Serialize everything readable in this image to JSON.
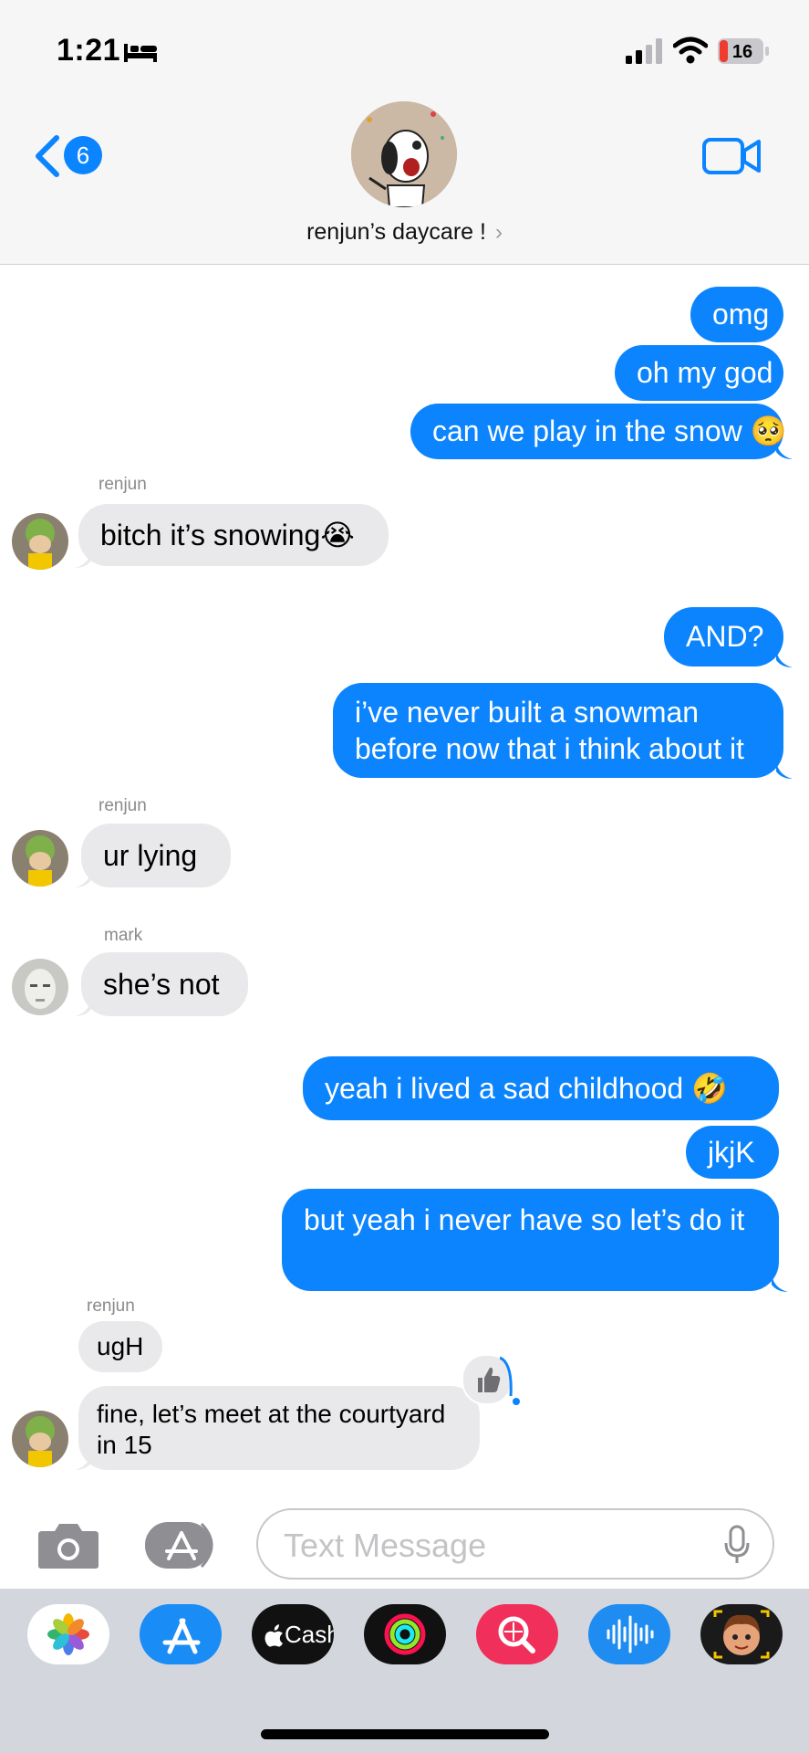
{
  "status_bar": {
    "time": "1:21",
    "battery": "16"
  },
  "header": {
    "back_badge": "6",
    "group_name": "renjun’s daycare !",
    "chevron": "›"
  },
  "messages": {
    "m1": "omg",
    "m2": "oh my god",
    "m3": "can we play in the snow 🥺",
    "s1": "renjun",
    "m4": "bitch it’s snowing😭",
    "m5": "AND?",
    "m6": "i’ve never built a snowman before now that i think about it",
    "s2": "renjun",
    "m7": "ur lying",
    "s3": "mark",
    "m8": "she’s not",
    "m9": "yeah i lived a sad childhood 🤣",
    "m10": "jkjK",
    "m11": "but yeah i never have so let’s do it",
    "s4": "renjun",
    "m12": "ugH",
    "m13": "fine, let’s meet at the courtyard in 15"
  },
  "compose": {
    "placeholder": "Text Message"
  },
  "drawer": {
    "cash_label": "Cash"
  },
  "colors": {
    "accent": "#0b84fe",
    "incoming": "#e9e9eb"
  }
}
